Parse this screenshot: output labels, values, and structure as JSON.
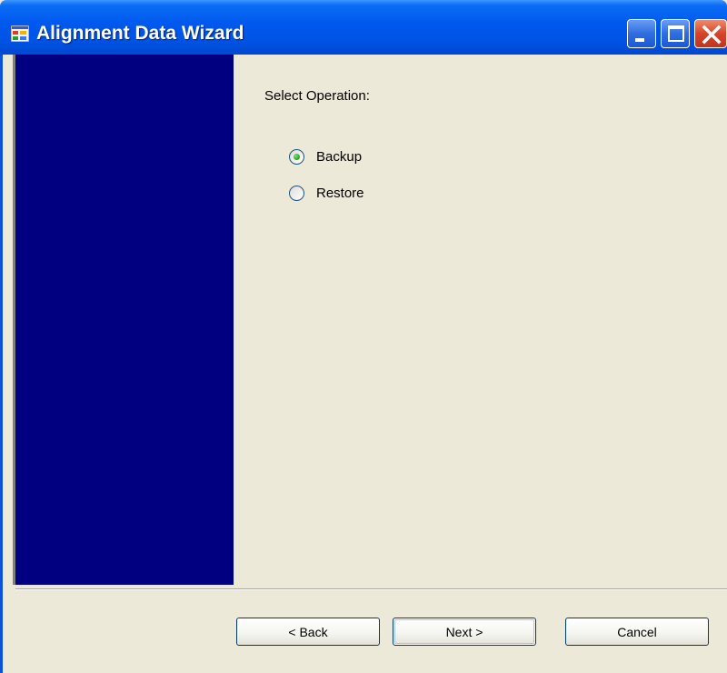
{
  "window": {
    "title": "Alignment Data Wizard",
    "title_bar_buttons": [
      "minimize-icon",
      "maximize-icon",
      "close-icon"
    ],
    "banner_color": "#000080"
  },
  "main": {
    "select_label": "Select Operation:",
    "options": [
      {
        "label": "Backup",
        "selected": true
      },
      {
        "label": "Restore",
        "selected": false
      }
    ]
  },
  "footer": {
    "back_label": "< Back",
    "next_label": "Next >",
    "cancel_label": "Cancel"
  }
}
